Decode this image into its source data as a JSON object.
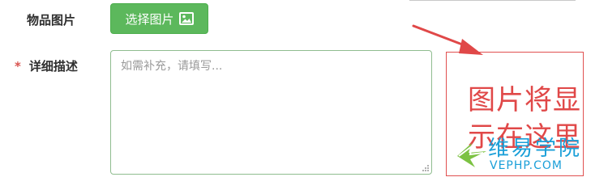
{
  "form": {
    "image_field": {
      "label": "物品图片",
      "button_label": "选择图片",
      "button_icon": "picture-icon"
    },
    "description_field": {
      "required_mark": "*",
      "label": "详细描述",
      "placeholder": "如需补充，请填写..."
    }
  },
  "preview": {
    "text": "图片将显示在这里"
  },
  "watermark": {
    "name": "维易学院",
    "url": "VEPHP.COM"
  },
  "colors": {
    "button_green": "#5cb85c",
    "annotation_red": "#e04848",
    "watermark_blue": "#1a9fd8",
    "label_text": "#2f2f2f"
  }
}
